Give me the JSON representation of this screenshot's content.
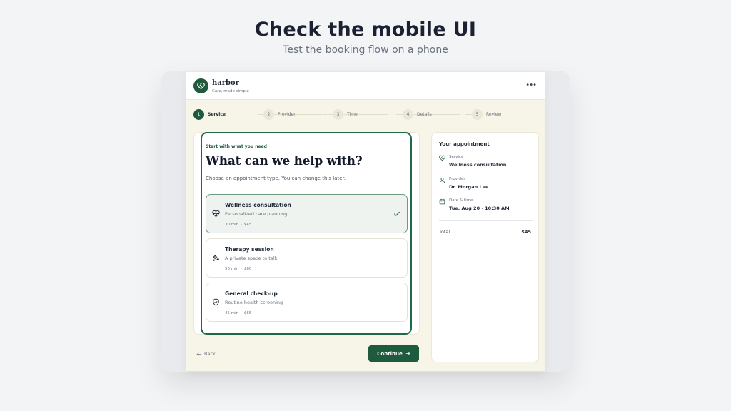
{
  "page": {
    "headline": "Check the mobile UI",
    "subheadline": "Test the booking flow on a phone"
  },
  "app": {
    "brand_name": "harbor",
    "brand_tagline": "Care, made simple",
    "menu_icon": "more-horizontal-icon",
    "colors": {
      "primary": "#1e5a3e",
      "background": "#f7f4e8",
      "selected_bg": "#eef3ef"
    }
  },
  "steps": [
    {
      "num": "1",
      "label": "Service",
      "active": true
    },
    {
      "num": "2",
      "label": "Provider",
      "active": false
    },
    {
      "num": "3",
      "label": "Time",
      "active": false
    },
    {
      "num": "4",
      "label": "Details",
      "active": false
    },
    {
      "num": "5",
      "label": "Review",
      "active": false
    }
  ],
  "main": {
    "eyebrow": "Start with what you need",
    "title": "What can we help with?",
    "description": "Choose an appointment type. You can change this later.",
    "options": [
      {
        "title": "Wellness consultation",
        "subtitle": "Personalized care planning",
        "duration": "30 min",
        "price": "$45",
        "icon": "heart-pulse-icon",
        "selected": true
      },
      {
        "title": "Therapy session",
        "subtitle": "A private space to talk",
        "duration": "50 min",
        "price": "$80",
        "icon": "sparkles-icon",
        "selected": false
      },
      {
        "title": "General check-up",
        "subtitle": "Routine health screening",
        "duration": "45 min",
        "price": "$65",
        "icon": "shield-check-icon",
        "selected": false
      }
    ]
  },
  "footer": {
    "back_label": "Back",
    "continue_label": "Continue"
  },
  "summary": {
    "title": "Your appointment",
    "service_label": "Service",
    "service_value": "Wellness consultation",
    "provider_label": "Provider",
    "provider_value": "Dr. Morgan Lee",
    "datetime_label": "Date & time",
    "datetime_value": "Tue, Aug 20 · 10:30 AM",
    "total_label": "Total",
    "total_value": "$45"
  }
}
